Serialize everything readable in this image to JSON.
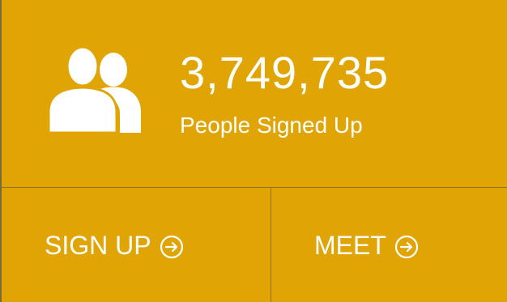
{
  "stats": {
    "count": "3,749,735",
    "label": "People Signed Up",
    "icon": "people-icon"
  },
  "actions": {
    "signup": {
      "label": "SIGN UP",
      "icon": "arrow-circle-right-icon"
    },
    "meet": {
      "label": "MEET",
      "icon": "arrow-circle-right-icon"
    }
  },
  "colors": {
    "background": "#e0a504",
    "text": "#ffffff",
    "divider": "#8f7420"
  }
}
